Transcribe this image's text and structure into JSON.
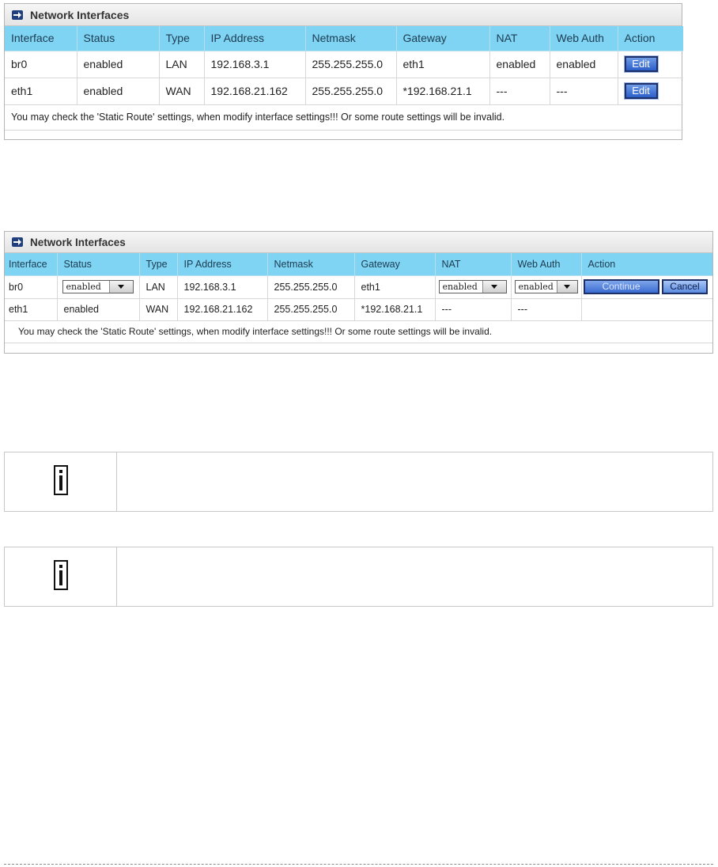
{
  "panel1": {
    "title": "Network Interfaces",
    "columns": [
      "Interface",
      "Status",
      "Type",
      "IP Address",
      "Netmask",
      "Gateway",
      "NAT",
      "Web Auth",
      "Action"
    ],
    "rows": [
      {
        "interface": "br0",
        "status": "enabled",
        "type": "LAN",
        "ip": "192.168.3.1",
        "netmask": "255.255.255.0",
        "gateway": "eth1",
        "nat": "enabled",
        "webauth": "enabled",
        "action": "Edit"
      },
      {
        "interface": "eth1",
        "status": "enabled",
        "type": "WAN",
        "ip": "192.168.21.162",
        "netmask": "255.255.255.0",
        "gateway": "*192.168.21.1",
        "nat": "---",
        "webauth": "---",
        "action": "Edit"
      }
    ],
    "notice": "You may check the 'Static Route' settings, when modify interface settings!!! Or some route settings will be invalid."
  },
  "panel2": {
    "title": "Network Interfaces",
    "columns": [
      "Interface",
      "Status",
      "Type",
      "IP Address",
      "Netmask",
      "Gateway",
      "NAT",
      "Web Auth",
      "Action"
    ],
    "rows": [
      {
        "interface": "br0",
        "status": "enabled",
        "type": "LAN",
        "ip": "192.168.3.1",
        "netmask": "255.255.255.0",
        "gateway": "eth1",
        "nat": "enabled",
        "webauth": "enabled",
        "continue": "Continue",
        "cancel": "Cancel"
      },
      {
        "interface": "eth1",
        "status": "enabled",
        "type": "WAN",
        "ip": "192.168.21.162",
        "netmask": "255.255.255.0",
        "gateway": "*192.168.21.1",
        "nat": "---",
        "webauth": "---"
      }
    ],
    "notice": "You may check the 'Static Route' settings, when modify interface settings!!! Or some route settings will be invalid."
  },
  "notes": [
    {
      "icon": "info-icon",
      "text": ""
    },
    {
      "icon": "info-icon",
      "text": ""
    }
  ],
  "colors": {
    "header_bar": "#7fd4f3",
    "edit_button": "#2c5fc9",
    "title_icon": "#1f3f7f"
  }
}
